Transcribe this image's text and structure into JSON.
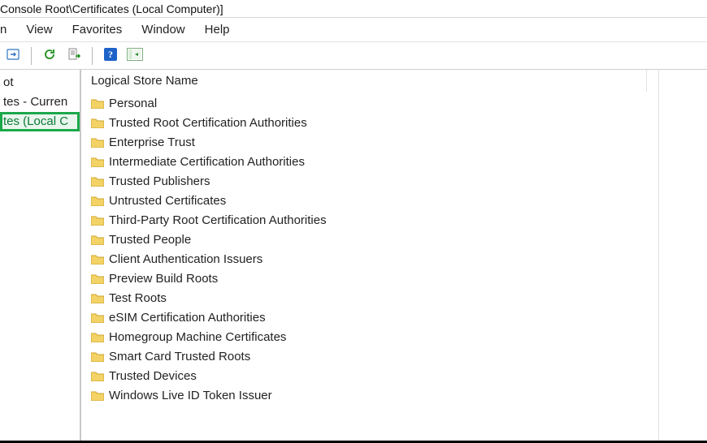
{
  "title": "Console Root\\Certificates (Local Computer)]",
  "menus": {
    "item0": "n",
    "item1": "View",
    "item2": "Favorites",
    "item3": "Window",
    "item4": "Help"
  },
  "tree": {
    "node0": "ot",
    "node1": "tes - Curren",
    "node2": "tes (Local C"
  },
  "column_header": "Logical Store Name",
  "stores": {
    "s0": "Personal",
    "s1": "Trusted Root Certification Authorities",
    "s2": "Enterprise Trust",
    "s3": "Intermediate Certification Authorities",
    "s4": "Trusted Publishers",
    "s5": "Untrusted Certificates",
    "s6": "Third-Party Root Certification Authorities",
    "s7": "Trusted People",
    "s8": "Client Authentication Issuers",
    "s9": "Preview Build Roots",
    "s10": "Test Roots",
    "s11": "eSIM Certification Authorities",
    "s12": "Homegroup Machine Certificates",
    "s13": "Smart Card Trusted Roots",
    "s14": "Trusted Devices",
    "s15": "Windows Live ID Token Issuer"
  }
}
